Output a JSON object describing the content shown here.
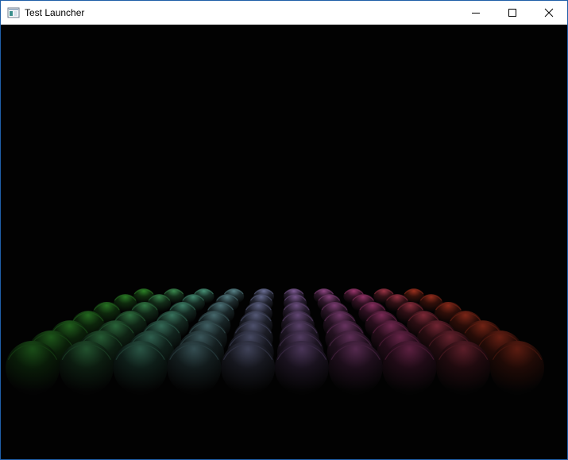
{
  "window": {
    "title": "Test Launcher",
    "app_icon": "window-app-icon",
    "controls": [
      "minimize-icon",
      "maximize-icon",
      "close-icon"
    ]
  },
  "scene": {
    "description_kind": "3d-render-viewport",
    "background": "#020202",
    "sphere_grid": {
      "rows": 7,
      "columns": 10,
      "color_gradient": [
        "#2f8a2a",
        "#4f9a86",
        "#7a6aa3",
        "#a23a7d",
        "#a3321f"
      ]
    }
  }
}
